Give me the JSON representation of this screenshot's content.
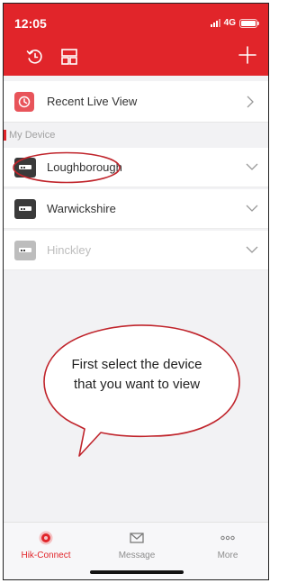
{
  "status_bar": {
    "time": "12:05",
    "network": "4G"
  },
  "toolbar": {
    "icons": [
      "history-icon",
      "layout-icon",
      "add-icon"
    ]
  },
  "recent_live_view": {
    "label": "Recent Live View",
    "icon": "clock-icon"
  },
  "section": {
    "label": "My Device"
  },
  "devices": [
    {
      "name": "Loughborough",
      "online": true,
      "icon": "device-icon"
    },
    {
      "name": "Warwickshire",
      "online": true,
      "icon": "device-icon"
    },
    {
      "name": "Hinckley",
      "online": false,
      "icon": "device-icon"
    }
  ],
  "annotation": {
    "line1": "First select the device",
    "line2": "that you want to view"
  },
  "tabbar": {
    "tabs": [
      {
        "label": "Hik-Connect",
        "icon": "hik-connect-icon",
        "active": true
      },
      {
        "label": "Message",
        "icon": "envelope-icon",
        "active": false
      },
      {
        "label": "More",
        "icon": "more-dots-icon",
        "active": false
      }
    ]
  },
  "colors": {
    "brand": "#e1252a",
    "device_online": "#3a3a3a",
    "device_offline": "#bdbdbd",
    "annotation": "#c0242b"
  }
}
